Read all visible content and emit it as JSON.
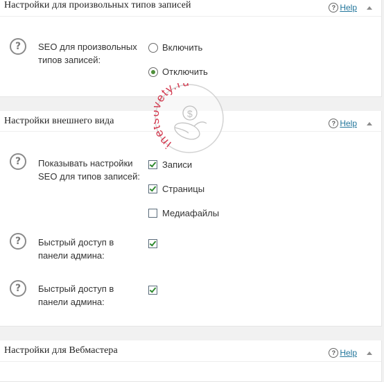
{
  "panels": [
    {
      "title": "Настройки для произвольных типов записей",
      "help": "Help",
      "options": [
        {
          "label": "SEO для произвольных типов записей:",
          "radios": [
            "Включить",
            "Отключить"
          ],
          "selected": 1
        }
      ]
    },
    {
      "title": "Настройки внешнего вида",
      "help": "Help",
      "options": [
        {
          "label": "Показывать настройки SEO для типов записей:",
          "checks": [
            {
              "label": "Записи",
              "checked": true
            },
            {
              "label": "Страницы",
              "checked": true
            },
            {
              "label": "Медиафайлы",
              "checked": false
            }
          ]
        },
        {
          "label": "Быстрый доступ в панели админа:",
          "checked": true
        },
        {
          "label": "Быстрый доступ в панели админа:",
          "checked": true
        }
      ]
    },
    {
      "title": "Настройки для Вебмастера",
      "help": "Help"
    }
  ],
  "watermark": {
    "text": "inetsovety.ru",
    "symbol": "$",
    "color": "#d0243c"
  },
  "icons": {
    "question": "?",
    "accent_link": "#21759b",
    "check_color": "#2f8a2f"
  }
}
